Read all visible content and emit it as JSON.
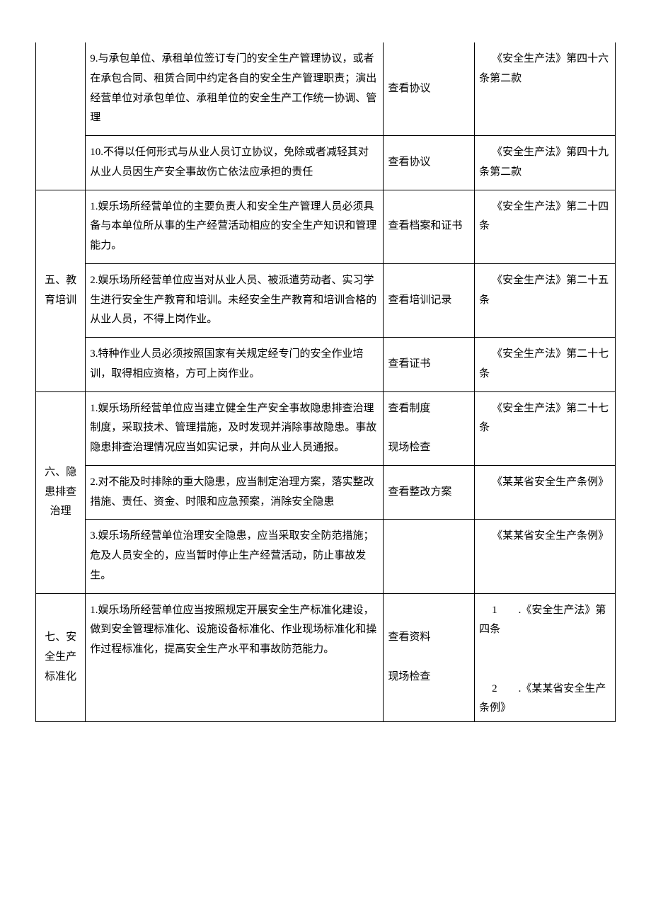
{
  "rows": [
    {
      "cat": "",
      "content": "9.与承包单位、承租单位签订专门的安全生产管理协议，或者在承包合同、租赁合同中约定各自的安全生产管理职责；演出经营单位对承包单位、承租单位的安全生产工作统一协调、管理",
      "check": "查看协议",
      "law": "《安全生产法》第四十六条第二款",
      "bottom": true
    },
    {
      "content": "10.不得以任何形式与从业人员订立协议，免除或者减轻其对从业人员因生产安全事故伤亡依法应承担的责任",
      "check": "查看协议",
      "law": "《安全生产法》第四十九条第二款",
      "bottom": true,
      "catBottom": true
    },
    {
      "cat": "五、教育培训",
      "catSpan": 3,
      "content": "1.娱乐场所经营单位的主要负责人和安全生产管理人员必须具备与本单位所从事的生产经营活动相应的安全生产知识和管理能力。",
      "check": "查看档案和证书",
      "law": "《安全生产法》第二十四条",
      "bottom": true
    },
    {
      "content": "2.娱乐场所经营单位应当对从业人员、被派遣劳动者、实习学生进行安全生产教育和培训。未经安全生产教育和培训合格的从业人员，不得上岗作业。",
      "check": "查看培训记录",
      "law": "《安全生产法》第二十五条",
      "bottom": true
    },
    {
      "content": "3.特种作业人员必须按照国家有关规定经专门的安全作业培训，取得相应资格，方可上岗作业。",
      "check": "查看证书",
      "law": "《安全生产法》第二十七条",
      "bottom": true,
      "catBottom": true
    },
    {
      "cat": "六、隐患排查治理",
      "catSpan": 3,
      "content": "1.娱乐场所经营单位应当建立健全生产安全事故隐患排查治理制度，采取技术、管理措施，及时发现并消除事故隐患。事故隐患排查治理情况应当如实记录，并向从业人员通报。",
      "check": "查看制度\n现场检查",
      "law": "《安全生产法》第二十七条",
      "bottom": true
    },
    {
      "content": "2.对不能及时排除的重大隐患，应当制定治理方案，落实整改措施、责任、资金、时限和应急预案，消除安全隐患",
      "check": "查看整改方案",
      "law": "《某某省安全生产条例》",
      "bottom": true
    },
    {
      "content": "3.娱乐场所经营单位治理安全隐患，应当采取安全防范措施；危及人员安全的，应当暂时停止生产经营活动，防止事故发生。",
      "check": "",
      "law": "《某某省安全生产条例》",
      "bottom": true,
      "catBottom": true
    },
    {
      "cat": "七、安全生产标准化",
      "catSpan": 1,
      "content": "1.娱乐场所经营单位应当按照规定开展安全生产标准化建设，做到安全管理标准化、设施设备标准化、作业现场标准化和操作过程标准化，提高安全生产水平和事故防范能力。",
      "check": "查看资料\n现场检查",
      "law": "1　　.《安全生产法》第四条\n\n2　　.《某某省安全生产条例》",
      "bottom": true,
      "catBottom": true
    }
  ]
}
